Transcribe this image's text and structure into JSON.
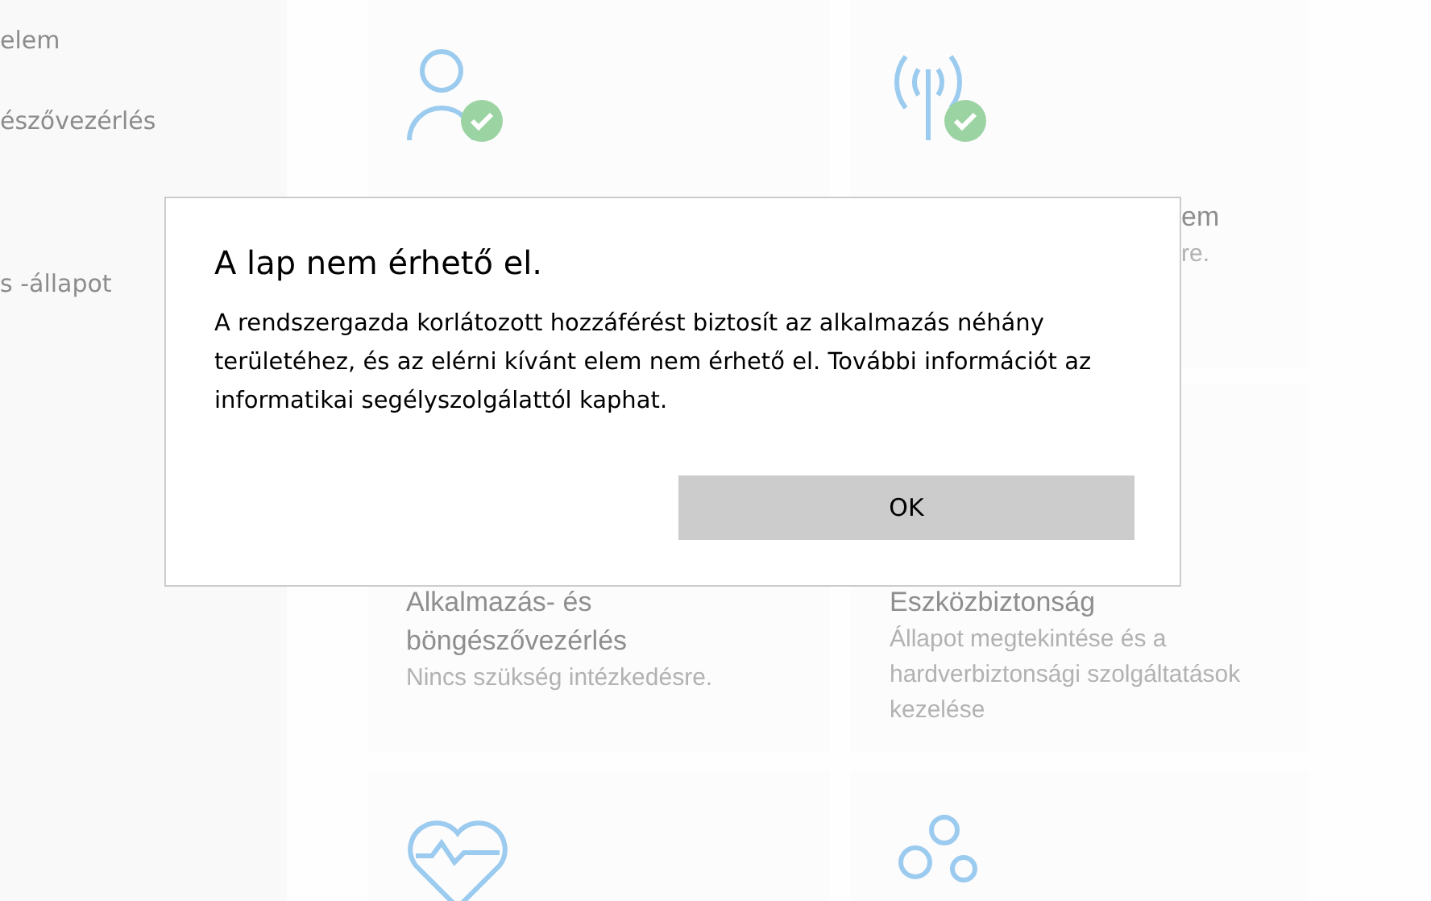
{
  "sidebar": {
    "items": [
      {
        "label": "elem"
      },
      {
        "label": "észővezérlés"
      },
      {
        "label": "s -állapot"
      }
    ]
  },
  "cards": [
    {
      "kind": "account",
      "check": true
    },
    {
      "kind": "network",
      "check": true,
      "title": "em",
      "description": "re.",
      "peek": true
    },
    {
      "kind": "apps",
      "title": "Alkalmazás- és böngészővezérlés",
      "description": "Nincs szükség intézkedésre."
    },
    {
      "kind": "device",
      "title": "Eszközbiztonság",
      "description": "Állapot megtekintése és a hardverbiztonsági szolgáltatások kezelése"
    },
    {
      "kind": "health"
    },
    {
      "kind": "family"
    }
  ],
  "dialog": {
    "title": "A lap nem érhető el.",
    "message": "A rendszergazda korlátozott hozzáférést biztosít az alkalmazás néhány területéhez, és az elérni kívánt elem nem érhető el. További információt az informatikai segélyszolgálattól kaphat.",
    "button": "OK"
  }
}
